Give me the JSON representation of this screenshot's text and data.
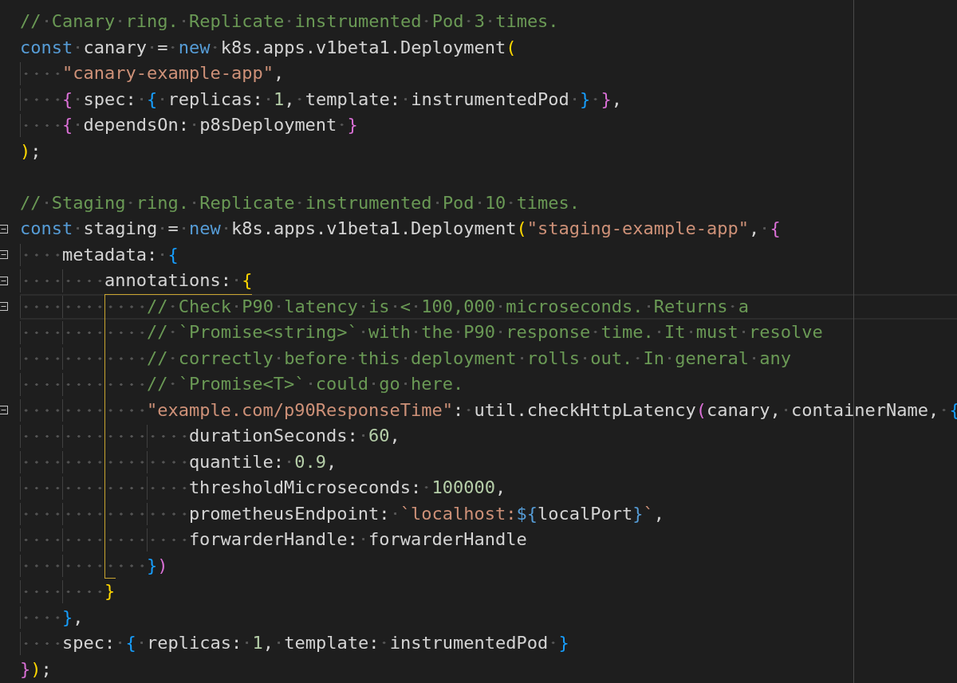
{
  "lines": [
    {
      "current": false,
      "tokens": [
        {
          "kind": "comment",
          "text": "// Canary ring. Replicate instrumented Pod 3 times."
        }
      ]
    },
    {
      "current": false,
      "tokens": [
        {
          "kind": "keyword",
          "text": "const"
        },
        {
          "kind": "plain",
          "text": " canary = "
        },
        {
          "kind": "keyword",
          "text": "new"
        },
        {
          "kind": "plain",
          "text": " k8s.apps.v1beta1.Deployment"
        },
        {
          "kind": "brace1",
          "text": "("
        }
      ]
    },
    {
      "current": false,
      "tokens": [
        {
          "kind": "string",
          "text": "    \"canary-example-app\""
        },
        {
          "kind": "plain",
          "text": ","
        }
      ]
    },
    {
      "current": false,
      "tokens": [
        {
          "kind": "brace2",
          "text": "    {"
        },
        {
          "kind": "plain",
          "text": " spec: "
        },
        {
          "kind": "brace3",
          "text": "{"
        },
        {
          "kind": "plain",
          "text": " replicas: "
        },
        {
          "kind": "number",
          "text": "1"
        },
        {
          "kind": "plain",
          "text": ", template: instrumentedPod "
        },
        {
          "kind": "brace3",
          "text": "}"
        },
        {
          "kind": "brace2",
          "text": " }"
        },
        {
          "kind": "plain",
          "text": ","
        }
      ]
    },
    {
      "current": false,
      "tokens": [
        {
          "kind": "brace2",
          "text": "    {"
        },
        {
          "kind": "plain",
          "text": " dependsOn: p8sDeployment "
        },
        {
          "kind": "brace2",
          "text": "}"
        }
      ]
    },
    {
      "current": false,
      "tokens": [
        {
          "kind": "brace1",
          "text": ")"
        },
        {
          "kind": "plain",
          "text": ";"
        }
      ]
    },
    {
      "current": false
    },
    {
      "current": false,
      "tokens": [
        {
          "kind": "comment",
          "text": "// Staging ring. Replicate instrumented Pod 10 times."
        }
      ]
    },
    {
      "current": false,
      "expanded": true,
      "tokens": [
        {
          "kind": "keyword",
          "text": "const"
        },
        {
          "kind": "plain",
          "text": " staging = "
        },
        {
          "kind": "keyword",
          "text": "new"
        },
        {
          "kind": "plain",
          "text": " k8s.apps.v1beta1.Deployment"
        },
        {
          "kind": "brace1",
          "text": "("
        },
        {
          "kind": "string",
          "text": "\"staging-example-app\""
        },
        {
          "kind": "plain",
          "text": ", "
        },
        {
          "kind": "brace2",
          "text": "{"
        }
      ]
    },
    {
      "current": false,
      "expanded": true,
      "tokens": [
        {
          "kind": "plain",
          "text": "    metadata: "
        },
        {
          "kind": "brace3",
          "text": "{"
        }
      ]
    },
    {
      "current": false,
      "expanded": true,
      "tokens": [
        {
          "kind": "plain",
          "text": "        annotations: "
        },
        {
          "kind": "brace1",
          "text": "{"
        }
      ]
    },
    {
      "current": true,
      "expanded": true,
      "tokens": [
        {
          "kind": "comment",
          "text": "            // Check P90 latency is < 100,000 microseconds. Returns a"
        }
      ]
    },
    {
      "current": false,
      "tokens": [
        {
          "kind": "comment",
          "text": "            // `Promise<string>` with the P90 response time. It must resolve"
        }
      ]
    },
    {
      "current": false,
      "tokens": [
        {
          "kind": "comment",
          "text": "            // correctly before this deployment rolls out. In general any"
        }
      ]
    },
    {
      "current": false,
      "tokens": [
        {
          "kind": "comment",
          "text": "            // `Promise<T>` could go here."
        }
      ]
    },
    {
      "current": false,
      "expanded": true,
      "tokens": [
        {
          "kind": "string",
          "text": "            \"example.com/p90ResponseTime\""
        },
        {
          "kind": "plain",
          "text": ": util.checkHttpLatency"
        },
        {
          "kind": "brace2",
          "text": "("
        },
        {
          "kind": "plain",
          "text": "canary, containerName, "
        },
        {
          "kind": "brace3",
          "text": "{"
        }
      ]
    },
    {
      "current": false,
      "tokens": [
        {
          "kind": "plain",
          "text": "                durationSeconds: "
        },
        {
          "kind": "number",
          "text": "60"
        },
        {
          "kind": "plain",
          "text": ","
        }
      ]
    },
    {
      "current": false,
      "tokens": [
        {
          "kind": "plain",
          "text": "                quantile: "
        },
        {
          "kind": "number",
          "text": "0.9"
        },
        {
          "kind": "plain",
          "text": ","
        }
      ]
    },
    {
      "current": false,
      "tokens": [
        {
          "kind": "plain",
          "text": "                thresholdMicroseconds: "
        },
        {
          "kind": "number",
          "text": "100000"
        },
        {
          "kind": "plain",
          "text": ","
        }
      ]
    },
    {
      "current": false,
      "tokens": [
        {
          "kind": "plain",
          "text": "                prometheusEndpoint: "
        },
        {
          "kind": "string",
          "text": "`localhost:"
        },
        {
          "kind": "keyword",
          "text": "${"
        },
        {
          "kind": "plain",
          "text": "localPort"
        },
        {
          "kind": "keyword",
          "text": "}"
        },
        {
          "kind": "string",
          "text": "`"
        },
        {
          "kind": "plain",
          "text": ","
        }
      ]
    },
    {
      "current": false,
      "tokens": [
        {
          "kind": "plain",
          "text": "                forwarderHandle: forwarderHandle"
        }
      ]
    },
    {
      "current": false,
      "tokens": [
        {
          "kind": "brace3",
          "text": "            }"
        },
        {
          "kind": "brace2",
          "text": ")"
        }
      ]
    },
    {
      "current": false,
      "tokens": [
        {
          "kind": "brace1",
          "text": "        }"
        }
      ]
    },
    {
      "current": false,
      "tokens": [
        {
          "kind": "brace3",
          "text": "    }"
        },
        {
          "kind": "plain",
          "text": ","
        }
      ]
    },
    {
      "current": false,
      "tokens": [
        {
          "kind": "plain",
          "text": "    spec: "
        },
        {
          "kind": "brace3",
          "text": "{"
        },
        {
          "kind": "plain",
          "text": " replicas: "
        },
        {
          "kind": "number",
          "text": "1"
        },
        {
          "kind": "plain",
          "text": ", template: instrumentedPod "
        },
        {
          "kind": "brace3",
          "text": "}"
        }
      ]
    },
    {
      "current": false,
      "tokens": [
        {
          "kind": "brace2",
          "text": "}"
        },
        {
          "kind": "brace1",
          "text": ")"
        },
        {
          "kind": "plain",
          "text": ";"
        }
      ]
    }
  ]
}
